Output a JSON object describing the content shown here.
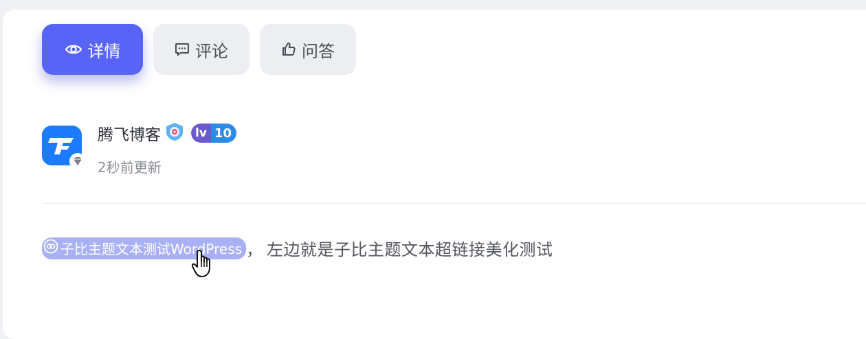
{
  "tabs": [
    {
      "label": "详情",
      "icon": "eye-icon",
      "active": true
    },
    {
      "label": "评论",
      "icon": "comment-icon",
      "active": false
    },
    {
      "label": "问答",
      "icon": "thumbs-up-icon",
      "active": false
    }
  ],
  "author": {
    "name": "腾飞博客",
    "level_prefix": "lv",
    "level_number": "10",
    "updated": "2秒前更新"
  },
  "content": {
    "link_text": "子比主题文本测试WordPress",
    "separator": "，",
    "rest_text": "左边就是子比主题文本超链接美化测试"
  },
  "colors": {
    "accent": "#5864f5",
    "link_bg": "#a9b0f5",
    "avatar_blue": "#1d7bff"
  }
}
